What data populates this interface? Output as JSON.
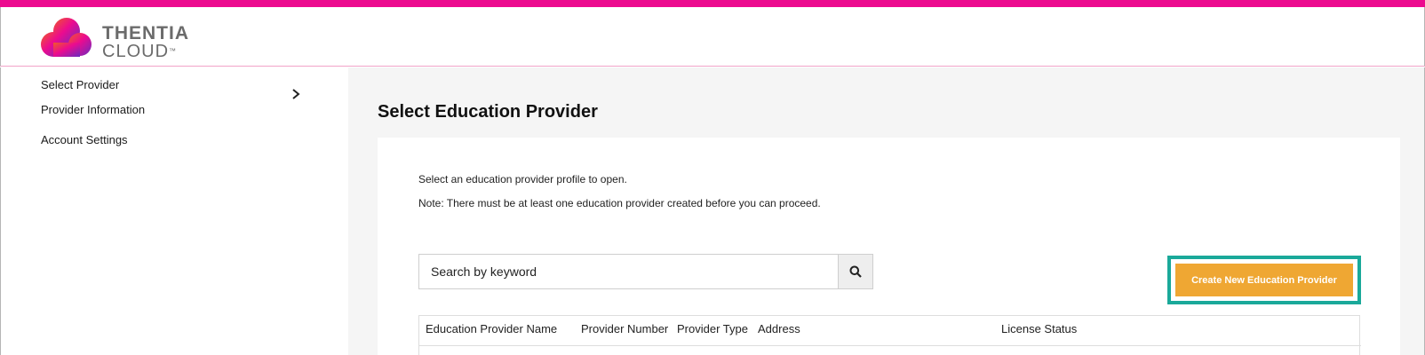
{
  "brand": {
    "name_line1": "THENTIA",
    "name_line2": "CLOUD",
    "trademark": "™",
    "accent_color": "#ec0b8f"
  },
  "sidebar": {
    "items": [
      {
        "label": "Select Provider",
        "active": true
      },
      {
        "label": "Provider Information",
        "active": false
      },
      {
        "label": "Account Settings",
        "active": false
      }
    ],
    "toggle_icon": "chevron-right-icon"
  },
  "main": {
    "title": "Select Education Provider",
    "intro": "Select an education provider profile to open.",
    "note": "Note: There must be at least one education provider created before you can proceed.",
    "search": {
      "placeholder": "Search by keyword",
      "value": "",
      "icon": "search-icon"
    },
    "create_button_label": "Create New Education Provider",
    "create_button_color": "#efa733",
    "highlight_color": "#1aa99a",
    "table": {
      "columns": [
        "Education Provider Name",
        "Provider Number",
        "Provider Type",
        "Address",
        "License Status"
      ]
    }
  }
}
